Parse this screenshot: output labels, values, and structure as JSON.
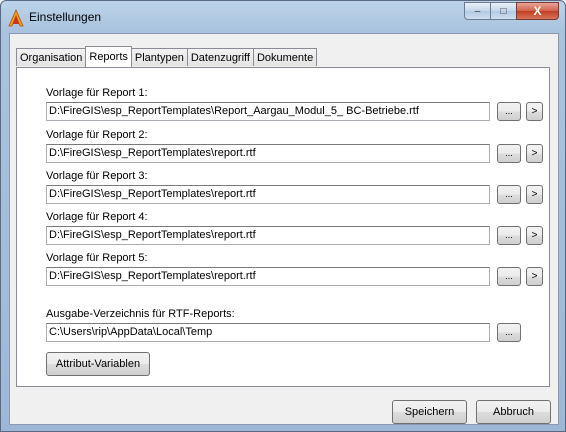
{
  "window": {
    "title": "Einstellungen",
    "controls": {
      "minimize": "–",
      "maximize": "□",
      "close": "X"
    }
  },
  "tabs": [
    {
      "label": "Organisation"
    },
    {
      "label": "Reports"
    },
    {
      "label": "Plantypen"
    },
    {
      "label": "Datenzugriff"
    },
    {
      "label": "Dokumente"
    }
  ],
  "active_tab": "Reports",
  "reports": [
    {
      "label": "Vorlage für Report 1:",
      "value": "D:\\FireGIS\\esp_ReportTemplates\\Report_Aargau_Modul_5_ BC-Betriebe.rtf"
    },
    {
      "label": "Vorlage für Report 2:",
      "value": "D:\\FireGIS\\esp_ReportTemplates\\report.rtf"
    },
    {
      "label": "Vorlage für Report 3:",
      "value": "D:\\FireGIS\\esp_ReportTemplates\\report.rtf"
    },
    {
      "label": "Vorlage für Report 4:",
      "value": "D:\\FireGIS\\esp_ReportTemplates\\report.rtf"
    },
    {
      "label": "Vorlage für Report 5:",
      "value": "D:\\FireGIS\\esp_ReportTemplates\\report.rtf"
    }
  ],
  "output": {
    "label": "Ausgabe-Verzeichnis für RTF-Reports:",
    "value": "C:\\Users\\rip\\AppData\\Local\\Temp"
  },
  "buttons": {
    "browse": "...",
    "open": ">",
    "attribute_vars": "Attribut-Variablen",
    "save": "Speichern",
    "cancel": "Abbruch"
  },
  "colors": {
    "accent_icon": "#e8a030"
  }
}
